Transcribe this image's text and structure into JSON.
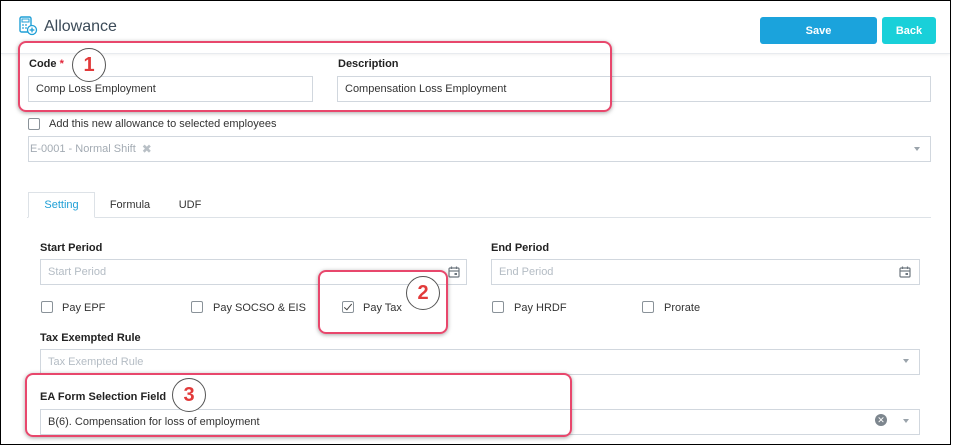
{
  "header": {
    "title": "Allowance",
    "icon": "calculator-add-icon",
    "save_label": "Save",
    "back_label": "Back",
    "save_color": "#1ba3dc",
    "back_color": "#19d0d9"
  },
  "form": {
    "code_label": "Code",
    "code_required_mark": "*",
    "code_value": "Comp Loss Employment",
    "description_label": "Description",
    "description_value": "Compensation Loss Employment",
    "add_to_employees_label": "Add this new allowance to selected employees",
    "add_to_employees_checked": false,
    "selected_employee_chip": "E-0001 - Normal Shift",
    "chip_remove_glyph": "✖"
  },
  "tabs": [
    {
      "label": "Setting",
      "active": true
    },
    {
      "label": "Formula",
      "active": false
    },
    {
      "label": "UDF",
      "active": false
    }
  ],
  "setting": {
    "start_period_label": "Start Period",
    "start_period_placeholder": "Start Period",
    "end_period_label": "End Period",
    "end_period_placeholder": "End Period",
    "checkboxes": [
      {
        "label": "Pay EPF",
        "checked": false
      },
      {
        "label": "Pay SOCSO & EIS",
        "checked": false
      },
      {
        "label": "Pay Tax",
        "checked": true
      },
      {
        "label": "Pay HRDF",
        "checked": false
      },
      {
        "label": "Prorate",
        "checked": false
      }
    ],
    "tax_exempted_label": "Tax Exempted Rule",
    "tax_exempted_placeholder": "Tax Exempted Rule",
    "ea_form_label": "EA Form Selection Field",
    "ea_form_value": "B(6). Compensation for loss of employment"
  },
  "annotations": [
    {
      "number": "1",
      "color": "#e8476c"
    },
    {
      "number": "2",
      "color": "#e8476c"
    },
    {
      "number": "3",
      "color": "#e8476c"
    }
  ]
}
